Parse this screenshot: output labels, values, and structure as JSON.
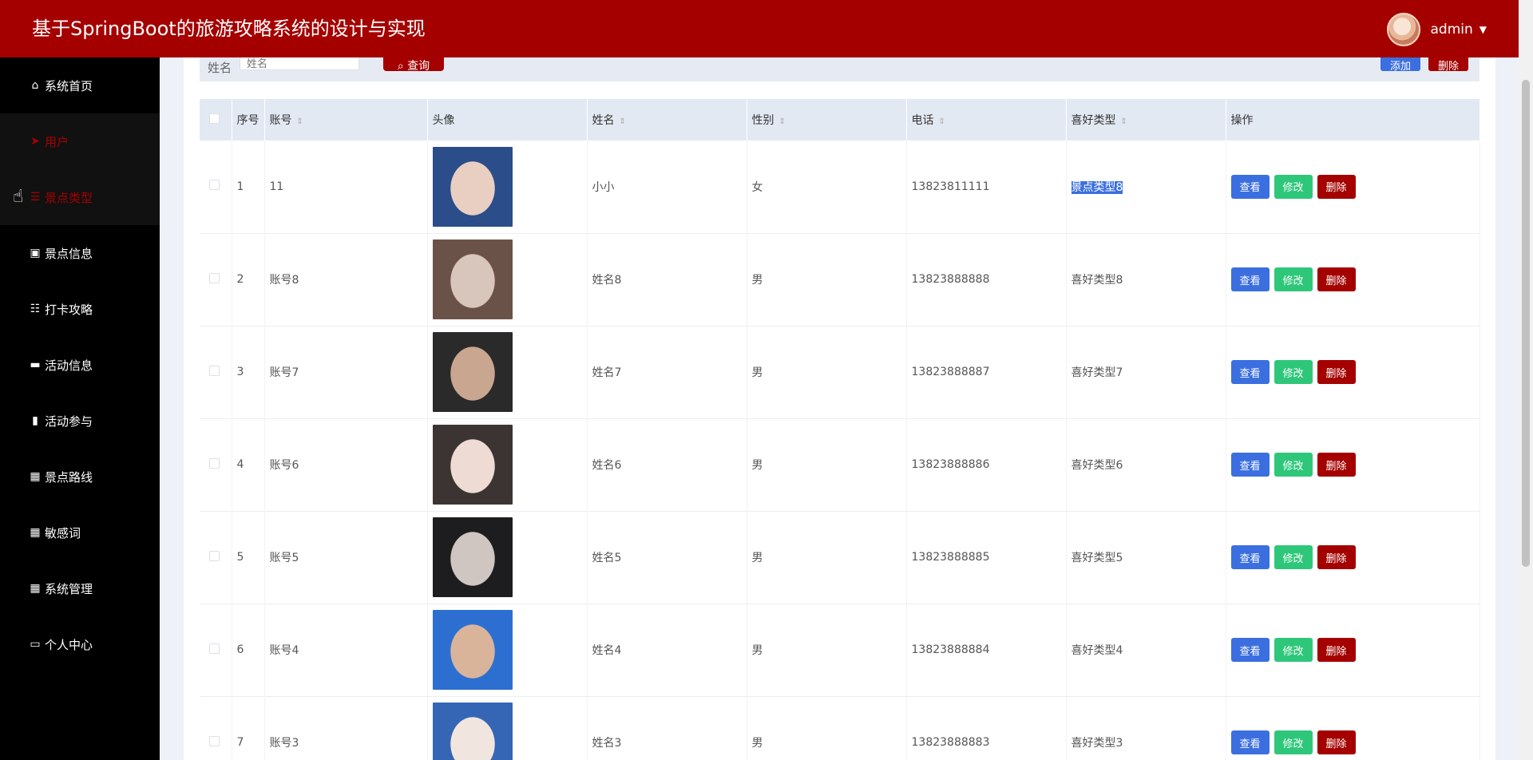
{
  "header": {
    "title": "基于SpringBoot的旅游攻略系统的设计与实现",
    "username": "admin"
  },
  "sidebar": {
    "items": [
      {
        "label": "系统首页",
        "icon": "home-icon",
        "glyph": "⌂",
        "active": false
      },
      {
        "label": "用户",
        "icon": "paper-plane-icon",
        "glyph": "➤",
        "active": true
      },
      {
        "label": "景点类型",
        "icon": "list-icon",
        "glyph": "☰",
        "active": true
      },
      {
        "label": "景点信息",
        "icon": "clipboard-icon",
        "glyph": "▣",
        "active": false
      },
      {
        "label": "打卡攻略",
        "icon": "sliders-icon",
        "glyph": "☷",
        "active": false
      },
      {
        "label": "活动信息",
        "icon": "briefcase-icon",
        "glyph": "▬",
        "active": false
      },
      {
        "label": "活动参与",
        "icon": "bar-chart-icon",
        "glyph": "▮",
        "active": false
      },
      {
        "label": "景点路线",
        "icon": "grid-icon",
        "glyph": "▦",
        "active": false
      },
      {
        "label": "敏感词",
        "icon": "grid-icon",
        "glyph": "▦",
        "active": false
      },
      {
        "label": "系统管理",
        "icon": "grid-icon",
        "glyph": "▦",
        "active": false
      },
      {
        "label": "个人中心",
        "icon": "id-card-icon",
        "glyph": "▭",
        "active": false
      }
    ]
  },
  "search": {
    "label": "姓名",
    "placeholder": "姓名",
    "button": "查询",
    "add_button": "添加",
    "delete_button": "删除"
  },
  "table": {
    "columns": [
      "序号",
      "账号",
      "头像",
      "姓名",
      "性别",
      "电话",
      "喜好类型",
      "操作"
    ],
    "actions": {
      "view": "查看",
      "edit": "修改",
      "delete": "删除"
    },
    "rows": [
      {
        "index": "1",
        "account": "11",
        "name": "小小",
        "gender": "女",
        "phone": "13823811111",
        "preference": "景点类型8",
        "photo_colors": [
          "#2b4d8a",
          "#e9cfc2"
        ]
      },
      {
        "index": "2",
        "account": "账号8",
        "name": "姓名8",
        "gender": "男",
        "phone": "13823888888",
        "preference": "喜好类型8",
        "photo_colors": [
          "#6b5248",
          "#d8c6bc"
        ]
      },
      {
        "index": "3",
        "account": "账号7",
        "name": "姓名7",
        "gender": "男",
        "phone": "13823888887",
        "preference": "喜好类型7",
        "photo_colors": [
          "#2a2a2a",
          "#c9a690"
        ]
      },
      {
        "index": "4",
        "account": "账号6",
        "name": "姓名6",
        "gender": "男",
        "phone": "13823888886",
        "preference": "喜好类型6",
        "photo_colors": [
          "#3c3433",
          "#eedbd4"
        ]
      },
      {
        "index": "5",
        "account": "账号5",
        "name": "姓名5",
        "gender": "男",
        "phone": "13823888885",
        "preference": "喜好类型5",
        "photo_colors": [
          "#1d1d1f",
          "#cfc5c1"
        ]
      },
      {
        "index": "6",
        "account": "账号4",
        "name": "姓名4",
        "gender": "男",
        "phone": "13823888884",
        "preference": "喜好类型4",
        "photo_colors": [
          "#2d6fd1",
          "#d9b49b"
        ]
      },
      {
        "index": "7",
        "account": "账号3",
        "name": "姓名3",
        "gender": "男",
        "phone": "13823888883",
        "preference": "喜好类型3",
        "photo_colors": [
          "#3566b5",
          "#f0e6df"
        ]
      }
    ]
  },
  "colors": {
    "brand": "#a50000",
    "view": "#3b6fe0",
    "edit": "#2ec77a",
    "delete": "#a50000"
  }
}
